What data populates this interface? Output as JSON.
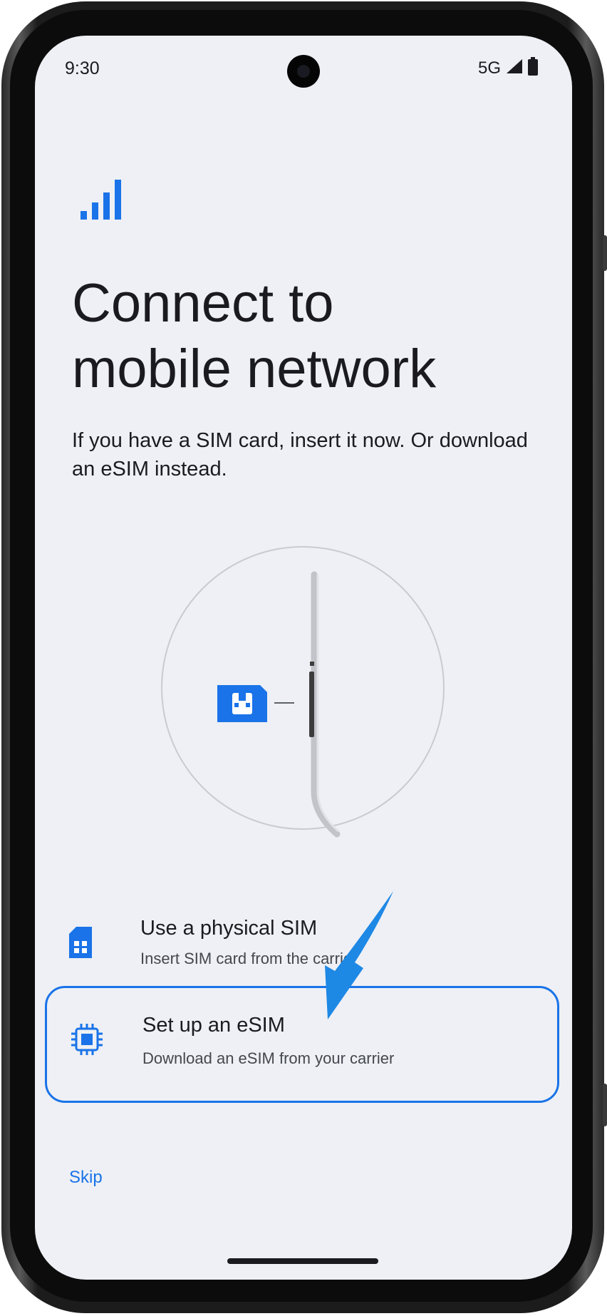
{
  "status_bar": {
    "time": "9:30",
    "network": "5G",
    "icons": [
      "signal-icon",
      "battery-icon"
    ]
  },
  "hero": {
    "icon": "signal-bars-icon",
    "title_line1": "Connect to",
    "title_line2": "mobile network",
    "subtitle": "If you have a SIM card, insert it now. Or download an eSIM instead."
  },
  "illustration": {
    "icon": "sim-card-icon"
  },
  "options": [
    {
      "icon": "sim-card-icon",
      "title": "Use a physical SIM",
      "description": "Insert SIM card from the carrier",
      "selected": false
    },
    {
      "icon": "chip-icon",
      "title": "Set up an eSIM",
      "description": "Download an eSIM from your carrier",
      "selected": true
    }
  ],
  "footer": {
    "skip_label": "Skip"
  },
  "colors": {
    "accent": "#1a73e8",
    "background": "#eef0f5",
    "text": "#1b1b1f",
    "annotation_arrow": "#1e88e5"
  }
}
